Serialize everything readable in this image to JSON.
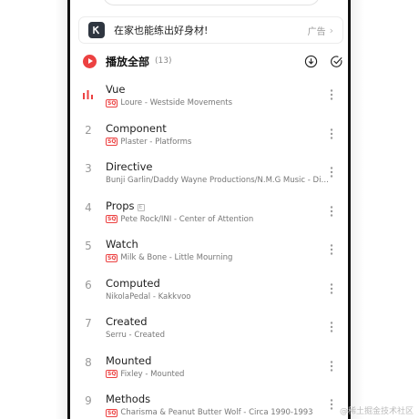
{
  "ad": {
    "text": "在家也能练出好身材!",
    "tag": "广告",
    "chevron": "›",
    "logo_icon": "k-logo-icon"
  },
  "play_all": {
    "label": "播放全部",
    "count": "(13)",
    "accent": "#ec4141"
  },
  "songs": [
    {
      "index": "",
      "playing": true,
      "title": "Vue",
      "sq": true,
      "badge": false,
      "subtitle": "Loure - Westside Movements"
    },
    {
      "index": "2",
      "playing": false,
      "title": "Component",
      "sq": true,
      "badge": false,
      "subtitle": "Plaster - Platforms"
    },
    {
      "index": "3",
      "playing": false,
      "title": "Directive",
      "sq": false,
      "badge": false,
      "subtitle": "Bunji Garlin/Daddy Wayne Productions/N.M.G Music - Directive"
    },
    {
      "index": "4",
      "playing": false,
      "title": "Props",
      "sq": true,
      "badge": true,
      "subtitle": "Pete Rock/INI - Center of Attention"
    },
    {
      "index": "5",
      "playing": false,
      "title": "Watch",
      "sq": true,
      "badge": false,
      "subtitle": "Milk & Bone - Little Mourning"
    },
    {
      "index": "6",
      "playing": false,
      "title": "Computed",
      "sq": false,
      "badge": false,
      "subtitle": "NikolaPedal - Kakkvoo"
    },
    {
      "index": "7",
      "playing": false,
      "title": "Created",
      "sq": false,
      "badge": false,
      "subtitle": "Serru - Created"
    },
    {
      "index": "8",
      "playing": false,
      "title": "Mounted",
      "sq": true,
      "badge": false,
      "subtitle": "Fixley - Mounted"
    },
    {
      "index": "9",
      "playing": false,
      "title": "Methods",
      "sq": true,
      "badge": false,
      "subtitle": "Charisma & Peanut Butter Wolf - Circa 1990-1993"
    }
  ],
  "labels": {
    "sq": "SQ",
    "e": "E"
  },
  "watermark": "@稀土掘金技术社区"
}
